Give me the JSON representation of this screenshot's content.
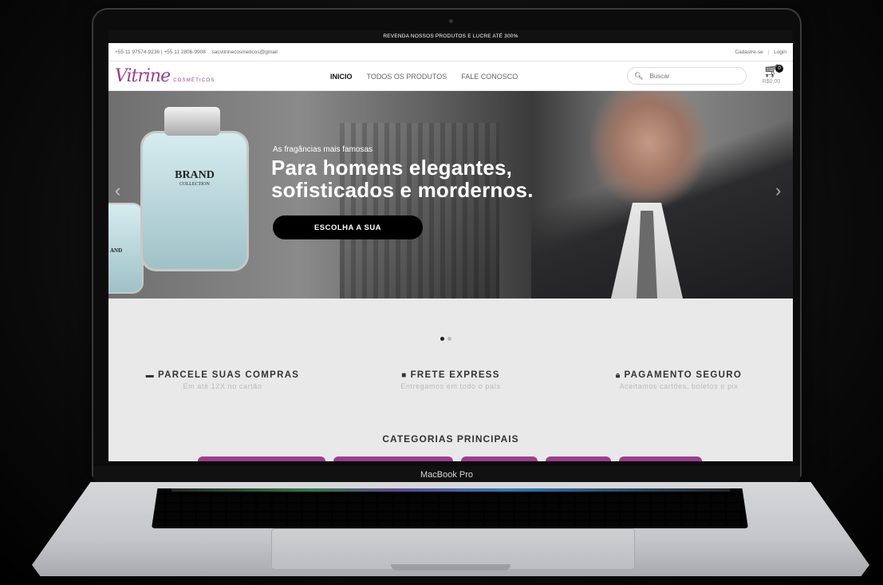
{
  "device": {
    "label": "MacBook Pro"
  },
  "site": {
    "announcement": "REVENDA NOSSOS PRODUTOS E LUCRE ATÉ 300%",
    "contact": {
      "phones": "+55 11 97574-9236 | +55 11 2806-9908",
      "email": "sacvitrinecosmeticos@gmail"
    },
    "account": {
      "signup": "Cadastre-se",
      "separator": "|",
      "login": "Login"
    },
    "logo": {
      "script": "Vitrine",
      "small": "COSMÉTICOS"
    },
    "nav": [
      {
        "label": "INICIO"
      },
      {
        "label": "TODOS OS PRODUTOS"
      },
      {
        "label": "FALE CONOSCO"
      }
    ],
    "search": {
      "placeholder": "Buscar"
    },
    "cart": {
      "count": "0",
      "total": "R$0,00"
    }
  },
  "hero": {
    "bottle_brand": "BRAND",
    "bottle_collection": "COLLECTION",
    "bottle2_brand": "AND",
    "subtitle": "As fragâncias mais famosas",
    "headline_line1": "Para homens elegantes,",
    "headline_line2": "sofisticados e mordernos.",
    "cta": "ESCOLHA A SUA",
    "slides": 2,
    "active_slide": 1
  },
  "features": [
    {
      "icon": "credit-card-icon",
      "title": "PARCELE SUAS COMPRAS",
      "subtitle": "Em até 12X no cartão"
    },
    {
      "icon": "truck-icon",
      "title": "FRETE EXPRESS",
      "subtitle": "Entregamos em todo o país"
    },
    {
      "icon": "lock-icon",
      "title": "PAGAMENTO SEGURO",
      "subtitle": "Aceitamos cartões, boletos e pix"
    }
  ],
  "categories": {
    "title": "CATEGORIAS PRINCIPAIS"
  },
  "colors": {
    "brand": "#9a3f8e",
    "topbar": "#111111",
    "cta": "#000000"
  }
}
